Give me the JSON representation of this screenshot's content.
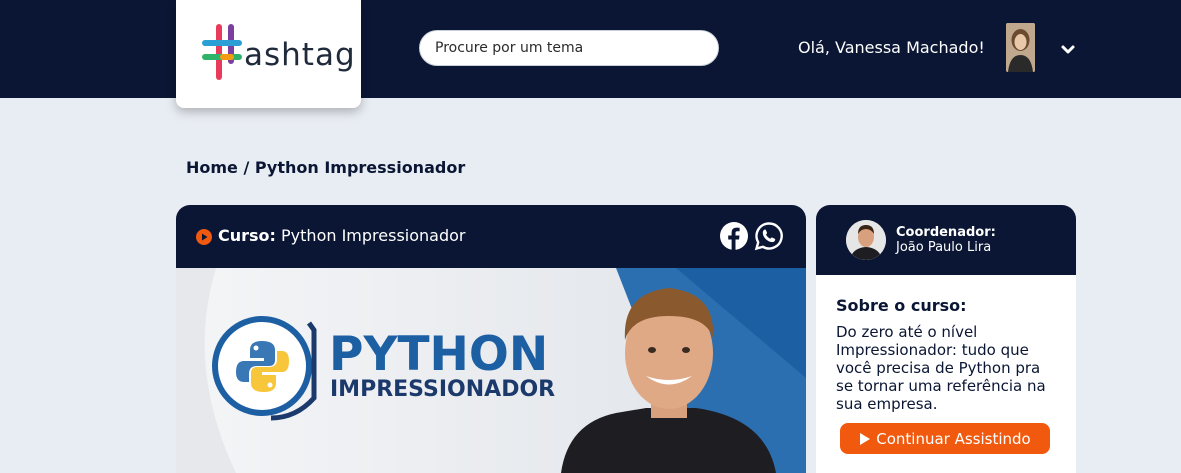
{
  "header": {
    "logo_text": "ashtag",
    "search_placeholder": "Procure por um tema",
    "greeting": "Olá, Vanessa Machado!"
  },
  "breadcrumb": {
    "text": "Home / Python Impressionador"
  },
  "course": {
    "label": "Curso:",
    "name": "Python Impressionador",
    "banner": {
      "title": "PYTHON",
      "subtitle": "IMPRESSIONADOR"
    }
  },
  "sidebar": {
    "coordinator_label": "Coordenador:",
    "coordinator_name": "João Paulo Lira",
    "about_title": "Sobre o curso:",
    "about_text": "Do zero até o nível Impressionador: tudo que você precisa de Python pra se tornar uma referência na sua empresa.",
    "continue_label": "Continuar Assistindo"
  },
  "colors": {
    "navy": "#0a1634",
    "accent": "#f15a0e",
    "background": "#e8edf3",
    "python_blue": "#1d5fa3",
    "python_navy": "#1b3a6b"
  },
  "icons": [
    "hashtag-logo-icon",
    "chevron-down-icon",
    "play-circle-icon",
    "facebook-icon",
    "whatsapp-icon",
    "python-logo-icon",
    "play-icon"
  ]
}
